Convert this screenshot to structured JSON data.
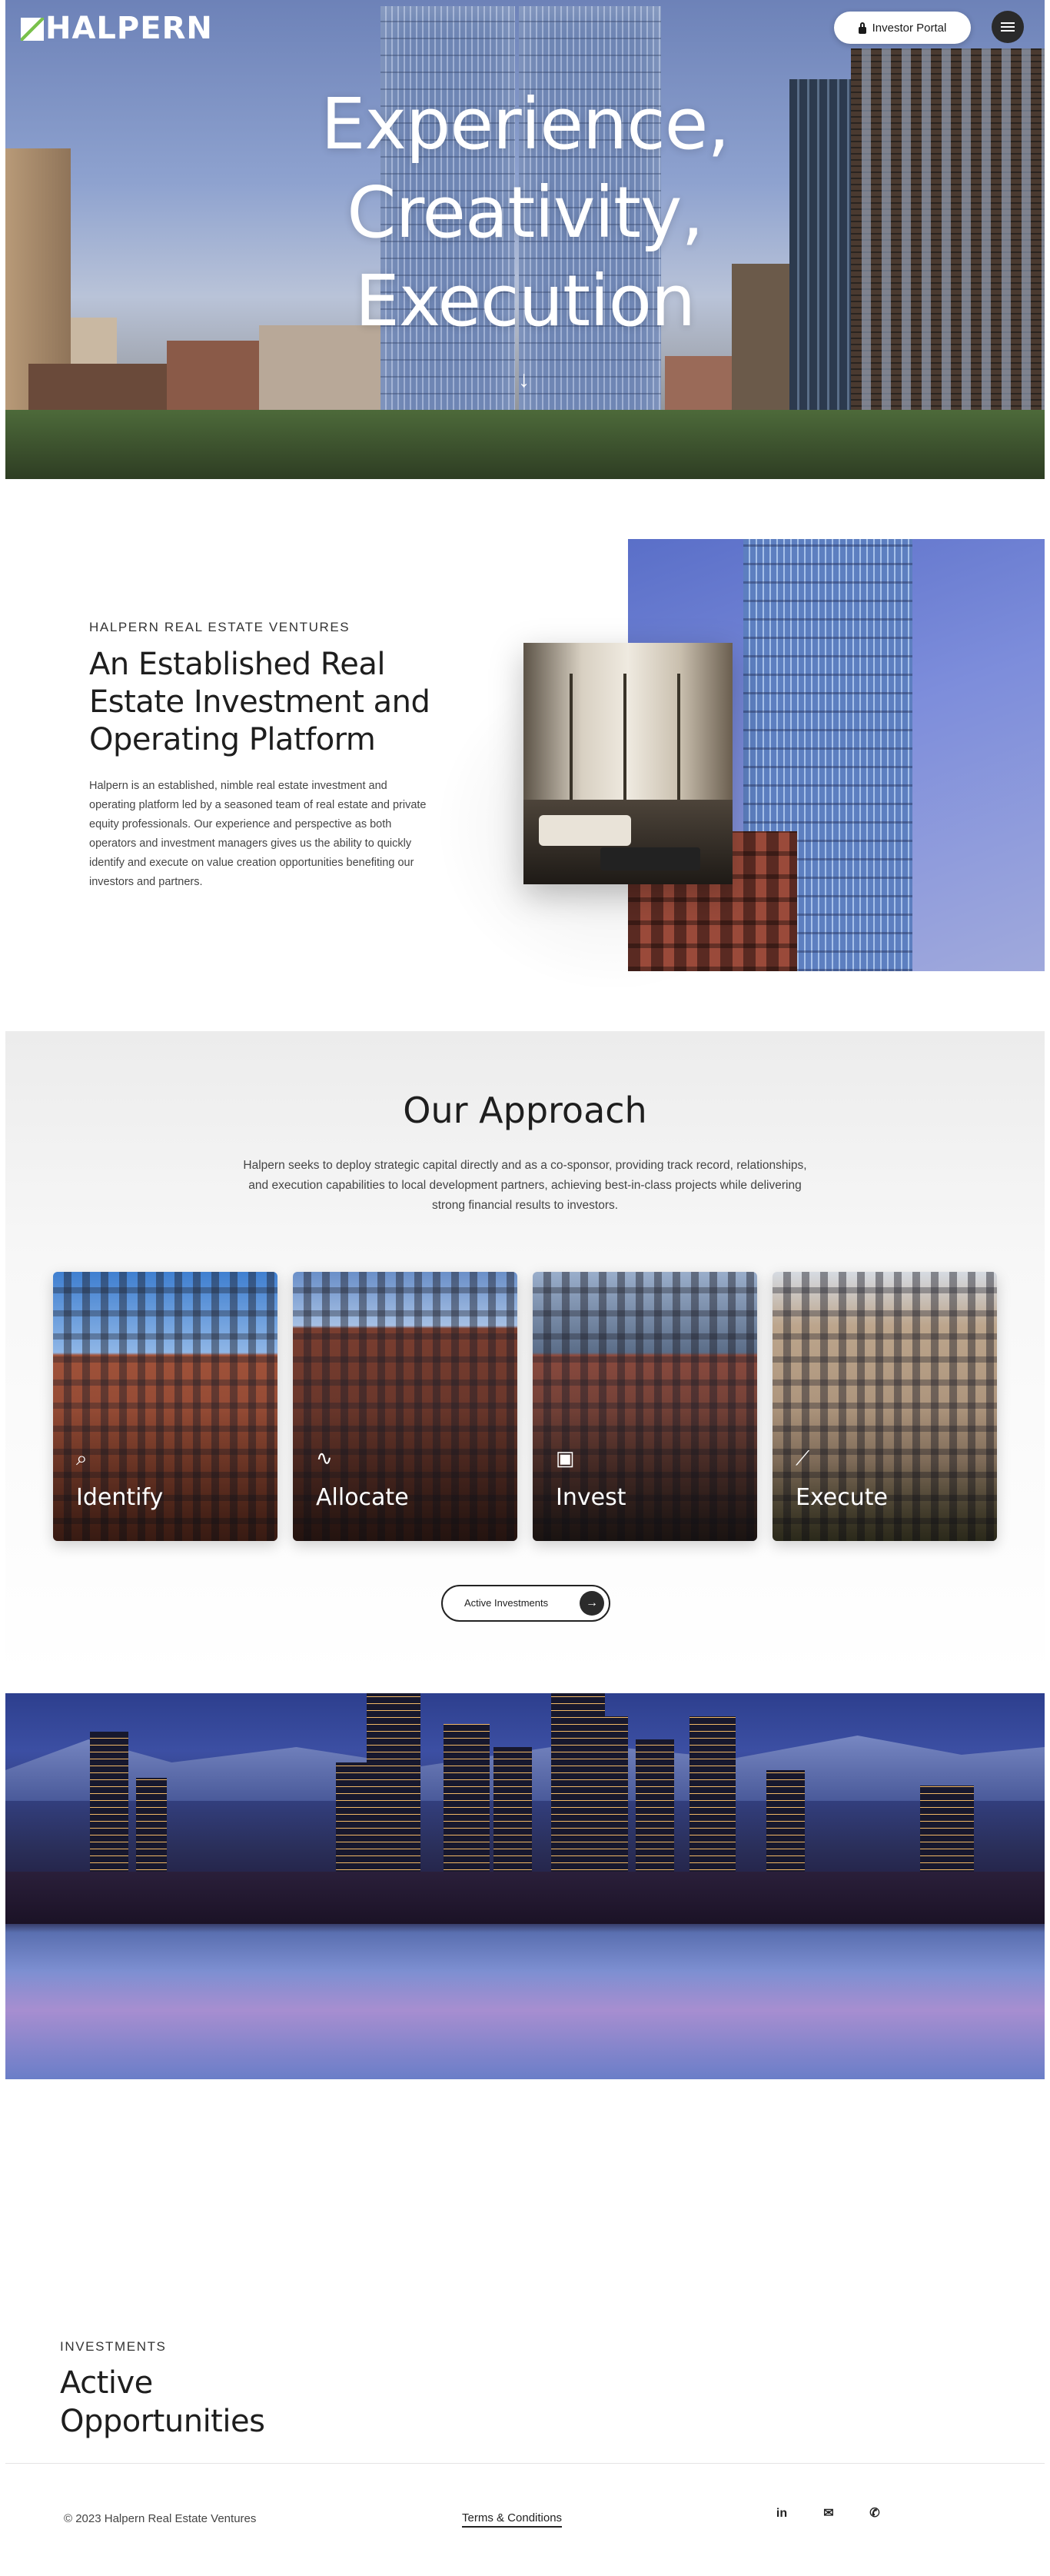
{
  "header": {
    "logo_text": "HALPERN",
    "investor_portal_label": "Investor Portal"
  },
  "hero": {
    "title_lines": [
      "Experience,",
      "Creativity,",
      "Execution"
    ],
    "scroll_arrow": "↓"
  },
  "about": {
    "eyebrow": "HALPERN REAL ESTATE VENTURES",
    "title_lines": [
      "An Established Real",
      "Estate Investment and",
      "Operating Platform"
    ],
    "body": "Halpern is an established, nimble real estate investment and operating platform led by a seasoned team of real estate and private equity professionals. Our experience and perspective as both operators and investment managers gives us the ability to quickly identify and execute on value creation opportunities benefiting our investors and partners."
  },
  "approach": {
    "title": "Our Approach",
    "body": "Halpern seeks to deploy strategic capital directly and as a co-sponsor, providing track record, relationships, and execution capabilities to local development partners, achieving best-in-class projects while delivering strong financial results to investors.",
    "cards": [
      {
        "label": "Identify",
        "icon": "search-icon",
        "glyph": "⌕"
      },
      {
        "label": "Allocate",
        "icon": "path-icon",
        "glyph": "∿"
      },
      {
        "label": "Invest",
        "icon": "money-icon",
        "glyph": "▣"
      },
      {
        "label": "Execute",
        "icon": "chart-icon",
        "glyph": "⟋"
      }
    ],
    "button_label": "Active Investments",
    "button_arrow": "→"
  },
  "investments": {
    "eyebrow": "INVESTMENTS",
    "title_lines": [
      "Active",
      "Opportunities"
    ]
  },
  "footer": {
    "copyright": "© 2023 Halpern Real Estate Ventures",
    "terms_label": "Terms & Conditions",
    "social": [
      {
        "icon": "linkedin-icon",
        "glyph": "in"
      },
      {
        "icon": "email-icon",
        "glyph": "✉"
      },
      {
        "icon": "phone-icon",
        "glyph": "✆"
      }
    ]
  },
  "colors": {
    "accent_green": "#7ac14b",
    "dark_button": "#2b2b2b",
    "text_dark": "#1e1e1e"
  }
}
